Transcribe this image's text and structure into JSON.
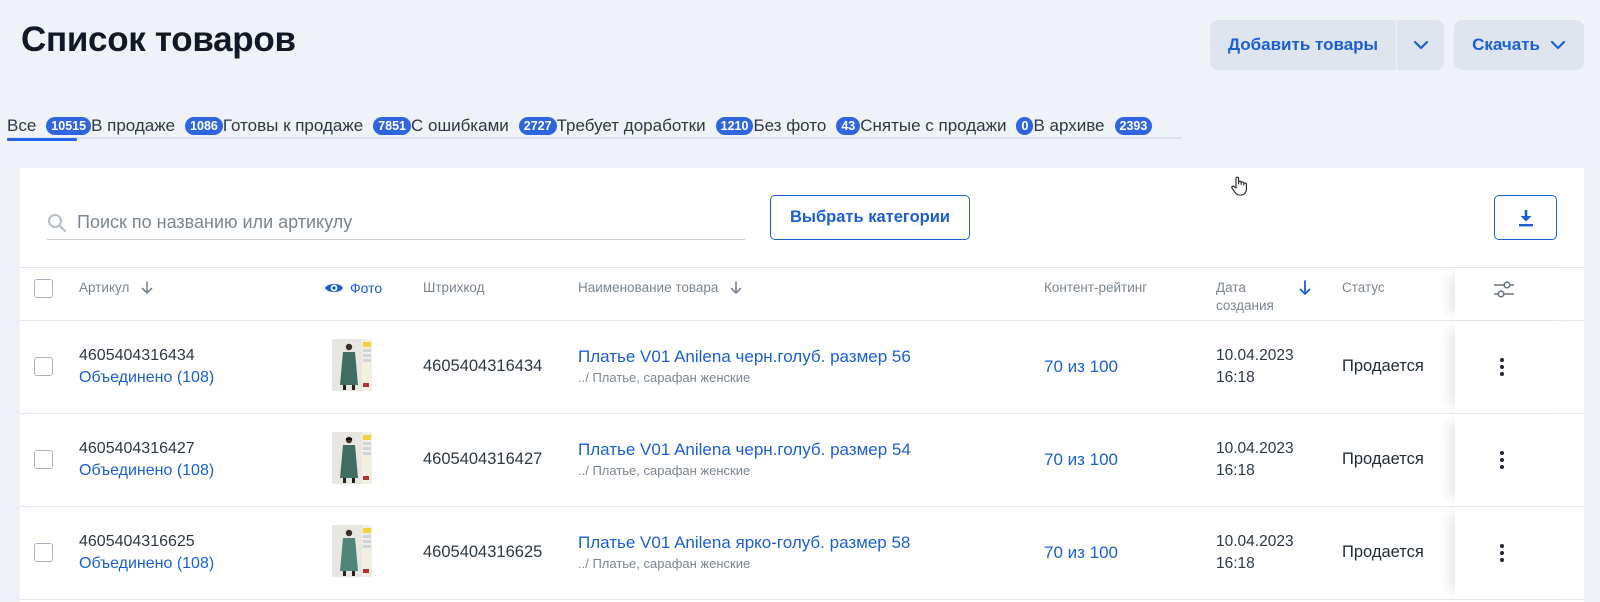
{
  "page": {
    "title": "Список товаров"
  },
  "actions": {
    "add_label": "Добавить товары",
    "download_label": "Скачать"
  },
  "tabs": [
    {
      "label": "Все",
      "count": "10515",
      "active": true
    },
    {
      "label": "В продаже",
      "count": "1086"
    },
    {
      "label": "Готовы к продаже",
      "count": "7851"
    },
    {
      "label": "С ошибками",
      "count": "2727"
    },
    {
      "label": "Требует доработки",
      "count": "1210"
    },
    {
      "label": "Без фото",
      "count": "43"
    },
    {
      "label": "Снятые с продажи",
      "count": "0"
    },
    {
      "label": "В архиве",
      "count": "2393"
    }
  ],
  "toolbar": {
    "search_placeholder": "Поиск по названию или артикулу",
    "categories_label": "Выбрать категории"
  },
  "table": {
    "headers": {
      "sku": "Артикул",
      "photo": "Фото",
      "barcode": "Штрихкод",
      "name": "Наименование товара",
      "rating": "Контент-рейтинг",
      "date_line1": "Дата",
      "date_line2": "создания",
      "status": "Статус"
    },
    "rows": [
      {
        "sku": "4605404316434",
        "merged": "Объединено (108)",
        "barcode": "4605404316434",
        "name": "Платье V01 Anilena черн.голуб. размер 56",
        "category": "../ Платье, сарафан женские",
        "rating": "70 из 100",
        "date": "10.04.2023",
        "time": "16:18",
        "status": "Продается"
      },
      {
        "sku": "4605404316427",
        "merged": "Объединено (108)",
        "barcode": "4605404316427",
        "name": "Платье V01 Anilena черн.голуб. размер 54",
        "category": "../ Платье, сарафан женские",
        "rating": "70 из 100",
        "date": "10.04.2023",
        "time": "16:18",
        "status": "Продается"
      },
      {
        "sku": "4605404316625",
        "merged": "Объединено (108)",
        "barcode": "4605404316625",
        "name": "Платье V01 Anilena ярко-голуб. размер 58",
        "category": "../ Платье, сарафан женские",
        "rating": "70 из 100",
        "date": "10.04.2023",
        "time": "16:18",
        "status": "Продается"
      }
    ]
  },
  "colors": {
    "accent": "#1b5fd6",
    "badge": "#2f66e0",
    "background": "#eff2f7"
  }
}
